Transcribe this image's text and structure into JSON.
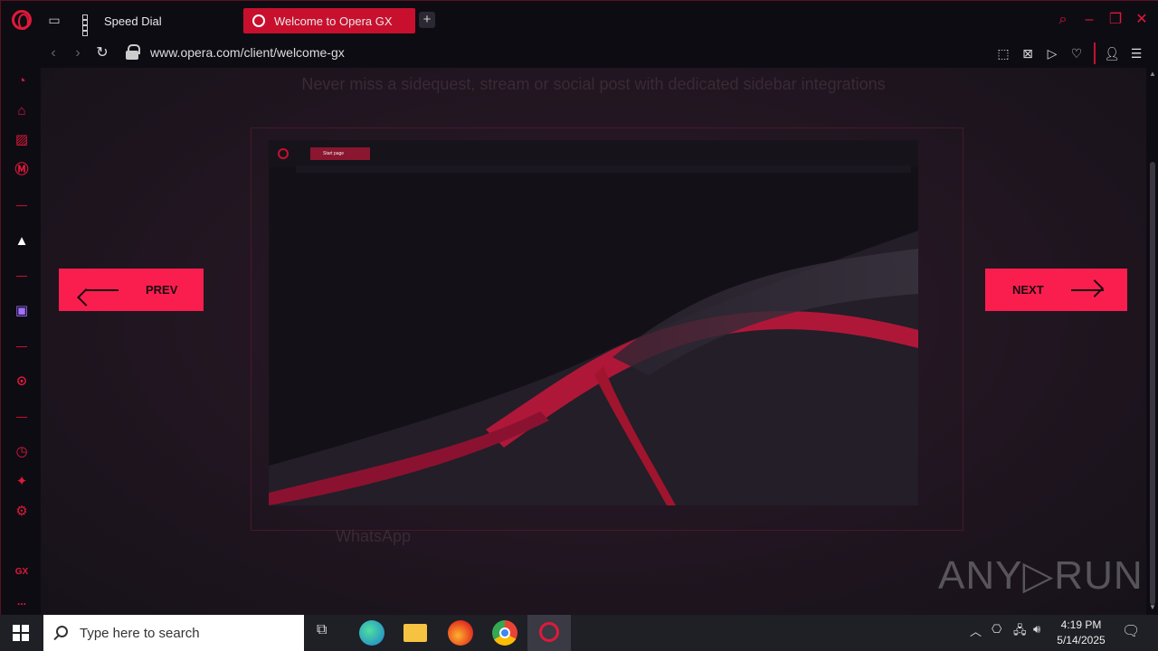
{
  "tabs": [
    {
      "label": "Speed Dial",
      "active": false
    },
    {
      "label": "Welcome to Opera GX",
      "active": true
    }
  ],
  "address_bar": {
    "url": "www.opera.com/client/welcome-gx"
  },
  "content": {
    "subtitle": "Never miss a sidequest, stream or social post with dedicated sidebar integrations",
    "mock_tab_label": "Start page",
    "ghost_label": "WhatsApp",
    "prev_label": "PREV",
    "next_label": "NEXT"
  },
  "sidebar": {
    "gx_label": "GX",
    "more_label": "..."
  },
  "watermark": "ANY▷RUN",
  "taskbar": {
    "search_placeholder": "Type here to search",
    "time": "4:19 PM",
    "date": "5/14/2025"
  },
  "colors": {
    "accent": "#fa1e4e",
    "brand": "#e0193a"
  }
}
